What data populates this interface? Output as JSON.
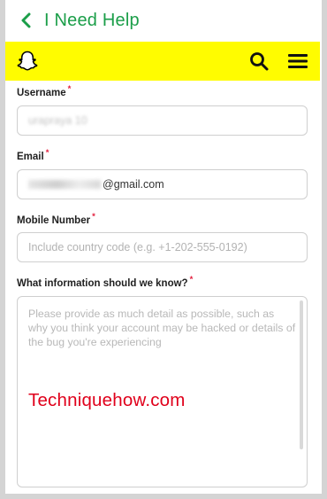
{
  "header": {
    "title": "I Need Help",
    "back_icon": "chevron-left-icon"
  },
  "snapbar": {
    "background": "#fffc00",
    "logo_icon": "snapchat-ghost-icon",
    "search_icon": "search-icon",
    "menu_icon": "hamburger-menu-icon"
  },
  "form": {
    "username": {
      "label": "Username",
      "required": "*",
      "value": "urapraya 10"
    },
    "email": {
      "label": "Email",
      "required": "*",
      "value_visible": "@gmail.com"
    },
    "mobile": {
      "label": "Mobile Number",
      "required": "*",
      "placeholder": "Include country code (e.g. +1-202-555-0192)"
    },
    "info": {
      "label": "What information should we know?",
      "required": "*",
      "placeholder": "Please provide as much detail as possible, such as why you think your account may be hacked or details of the bug you're experiencing"
    }
  },
  "watermark": "Techniquehow.com",
  "colors": {
    "accent_green": "#1b9e49",
    "required_red": "#e21d3c",
    "watermark_red": "#e0001b"
  }
}
